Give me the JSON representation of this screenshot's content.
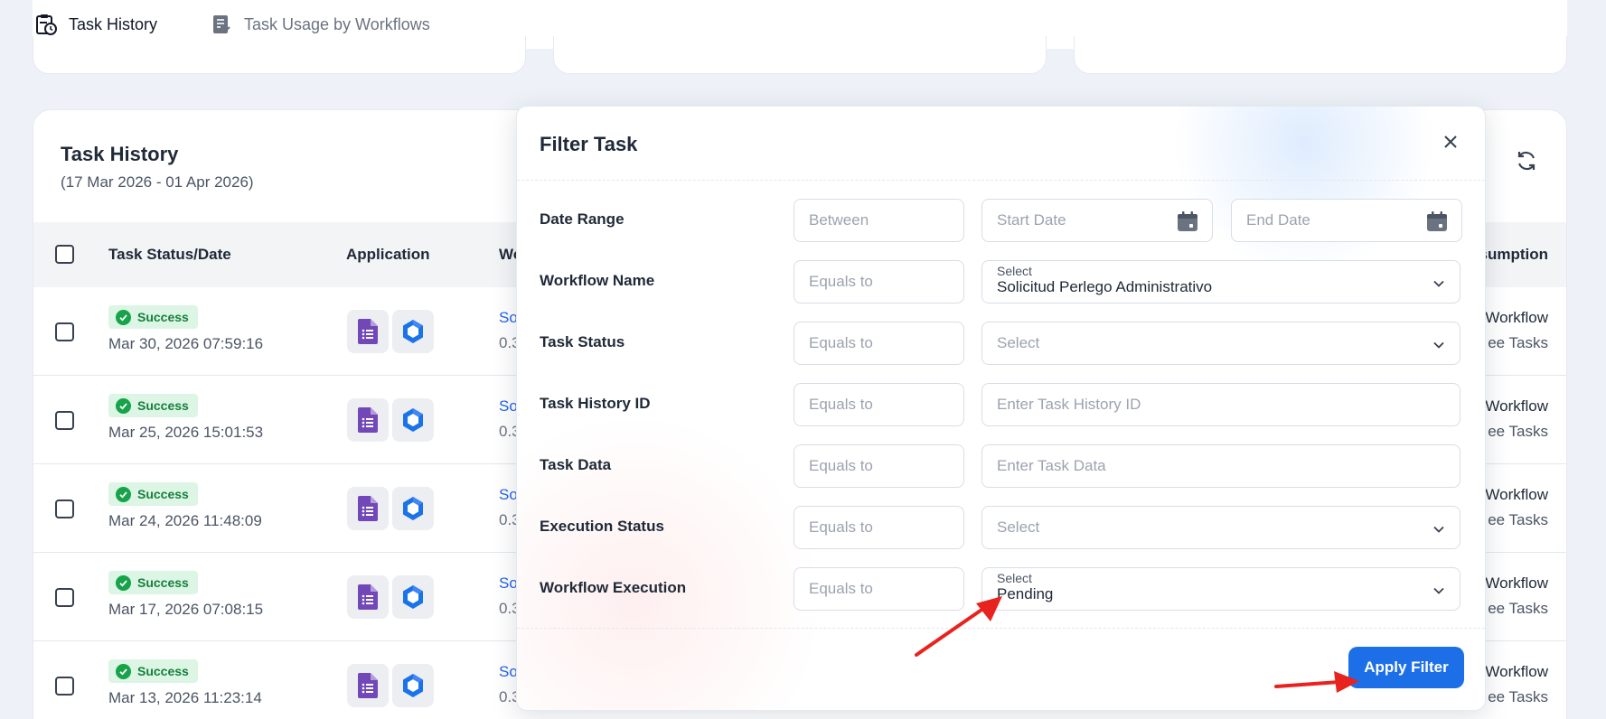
{
  "tabs": [
    {
      "label": "Task History",
      "icon": "clipboard-clock-icon",
      "active": true
    },
    {
      "label": "Task Usage by Workflows",
      "icon": "checklist-icon",
      "active": false
    }
  ],
  "panel": {
    "title": "Task History",
    "date_range": "(17 Mar 2026 - 01 Apr 2026)"
  },
  "table": {
    "columns": [
      "Task Status/Date",
      "Application",
      "Wo",
      "sumption"
    ],
    "rows": [
      {
        "status": "Success",
        "date": "Mar 30, 2026 07:59:16",
        "workflow": "So",
        "sub": "0.3",
        "right1": "Workflow",
        "right2": "ee Tasks"
      },
      {
        "status": "Success",
        "date": "Mar 25, 2026 15:01:53",
        "workflow": "So",
        "sub": "0.3",
        "right1": "Workflow",
        "right2": "ee Tasks"
      },
      {
        "status": "Success",
        "date": "Mar 24, 2026 11:48:09",
        "workflow": "So",
        "sub": "0.3",
        "right1": "Workflow",
        "right2": "ee Tasks"
      },
      {
        "status": "Success",
        "date": "Mar 17, 2026 07:08:15",
        "workflow": "So",
        "sub": "0.3",
        "right1": "Workflow",
        "right2": "ee Tasks"
      },
      {
        "status": "Success",
        "date": "Mar 13, 2026 11:23:14",
        "workflow": "So",
        "sub": "0.3",
        "right1": "Workflow",
        "right2": "ee Tasks"
      }
    ]
  },
  "modal": {
    "title": "Filter Task",
    "date_range": {
      "label": "Date Range",
      "operator": "Between",
      "start_placeholder": "Start Date",
      "end_placeholder": "End Date"
    },
    "workflow_name": {
      "label": "Workflow Name",
      "operator": "Equals to",
      "float_label": "Select",
      "value": "Solicitud Perlego Administrativo"
    },
    "task_status": {
      "label": "Task Status",
      "operator": "Equals to",
      "placeholder": "Select"
    },
    "task_history_id": {
      "label": "Task History ID",
      "operator": "Equals to",
      "placeholder": "Enter Task History ID"
    },
    "task_data": {
      "label": "Task Data",
      "operator": "Equals to",
      "placeholder": "Enter Task Data"
    },
    "execution_status": {
      "label": "Execution Status",
      "operator": "Equals to",
      "placeholder": "Select"
    },
    "workflow_execution": {
      "label": "Workflow Execution",
      "operator": "Equals to",
      "float_label": "Select",
      "value": "Pending"
    },
    "apply_label": "Apply Filter"
  },
  "colors": {
    "primary": "#1d6fe8",
    "success_bg": "#dcf5e4",
    "success_text": "#16803c",
    "link": "#2563eb",
    "annotation_arrow": "#e8231f"
  }
}
